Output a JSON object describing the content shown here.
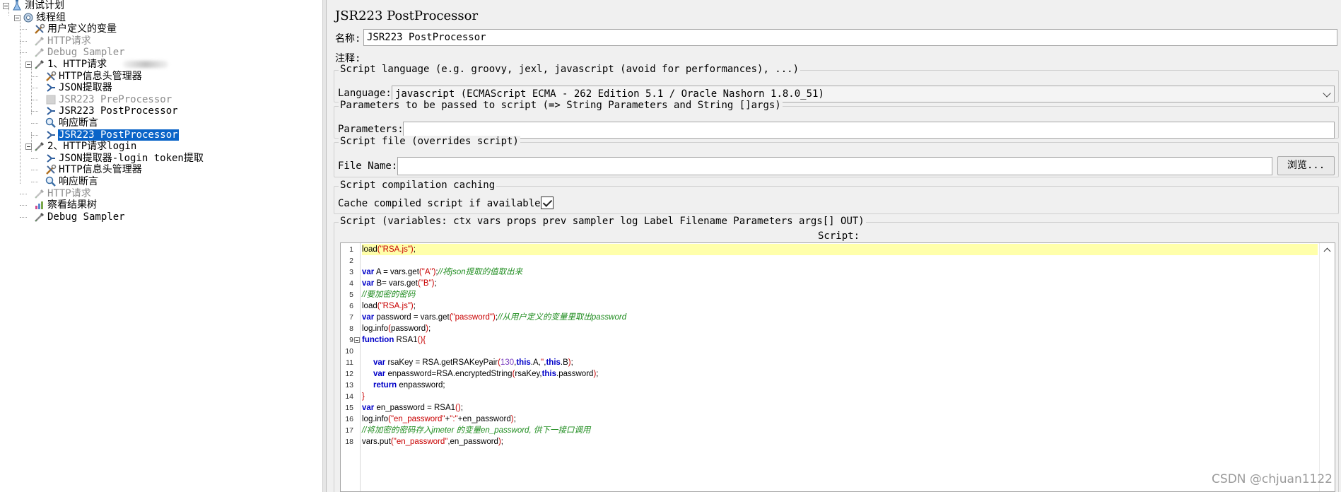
{
  "tree": {
    "items": [
      {
        "label": "测试计划",
        "icon": "test-plan-icon",
        "level": 0,
        "disabled": false,
        "selected": false,
        "expandable": true
      },
      {
        "label": "线程组",
        "icon": "thread-group-icon",
        "level": 1,
        "disabled": false,
        "selected": false,
        "expandable": true
      },
      {
        "label": "用户定义的变量",
        "icon": "config-tools-icon",
        "level": 2,
        "disabled": false,
        "selected": false,
        "expandable": false
      },
      {
        "label": "HTTP请求",
        "icon": "sampler-pipette-icon",
        "level": 2,
        "disabled": true,
        "selected": false,
        "expandable": false
      },
      {
        "label": "Debug Sampler",
        "icon": "sampler-pipette-icon",
        "level": 2,
        "disabled": true,
        "selected": false,
        "expandable": false
      },
      {
        "label": "1、HTTP请求",
        "icon": "sampler-pipette-icon",
        "level": 2,
        "disabled": false,
        "selected": false,
        "expandable": true
      },
      {
        "label": "HTTP信息头管理器",
        "icon": "config-tools-icon",
        "level": 3,
        "disabled": false,
        "selected": false,
        "expandable": false
      },
      {
        "label": "JSON提取器",
        "icon": "post-processor-icon",
        "level": 3,
        "disabled": false,
        "selected": false,
        "expandable": false
      },
      {
        "label": "JSR223 PreProcessor",
        "icon": "pre-processor-icon",
        "level": 3,
        "disabled": true,
        "selected": false,
        "expandable": false
      },
      {
        "label": "JSR223 PostProcessor",
        "icon": "post-processor-icon",
        "level": 3,
        "disabled": false,
        "selected": false,
        "expandable": false
      },
      {
        "label": "响应断言",
        "icon": "assertion-magnifier-icon",
        "level": 3,
        "disabled": false,
        "selected": false,
        "expandable": false
      },
      {
        "label": "JSR223 PostProcessor",
        "icon": "post-processor-icon",
        "level": 3,
        "disabled": false,
        "selected": true,
        "expandable": false
      },
      {
        "label": "2、HTTP请求login",
        "icon": "sampler-pipette-icon",
        "level": 2,
        "disabled": false,
        "selected": false,
        "expandable": true
      },
      {
        "label": "JSON提取器-login token提取",
        "icon": "post-processor-icon",
        "level": 3,
        "disabled": false,
        "selected": false,
        "expandable": false
      },
      {
        "label": "HTTP信息头管理器",
        "icon": "config-tools-icon",
        "level": 3,
        "disabled": false,
        "selected": false,
        "expandable": false
      },
      {
        "label": "响应断言",
        "icon": "assertion-magnifier-icon",
        "level": 3,
        "disabled": false,
        "selected": false,
        "expandable": false
      },
      {
        "label": "HTTP请求",
        "icon": "sampler-pipette-icon",
        "level": 2,
        "disabled": true,
        "selected": false,
        "expandable": false
      },
      {
        "label": "察看结果树",
        "icon": "listener-chart-icon",
        "level": 2,
        "disabled": false,
        "selected": false,
        "expandable": false
      },
      {
        "label": "Debug Sampler",
        "icon": "sampler-pipette-icon",
        "level": 2,
        "disabled": false,
        "selected": false,
        "expandable": false
      }
    ]
  },
  "panel": {
    "title": "JSR223 PostProcessor",
    "name_label": "名称:",
    "name_value": "JSR223 PostProcessor",
    "comment_label": "注释:",
    "comment_value": "",
    "language_group": "Script language (e.g. groovy, jexl, javascript (avoid for performances), ...)",
    "language_label": "Language:",
    "language_value": "javascript     (ECMAScript ECMA - 262 Edition 5.1 / Oracle Nashorn 1.8.0_51)",
    "parameters_group": "Parameters to be passed to script (=> String Parameters and String []args)",
    "parameters_label": "Parameters:",
    "parameters_value": "",
    "file_group": "Script file (overrides script)",
    "file_label": "File Name:",
    "file_value": "",
    "browse_label": "浏览...",
    "cache_group": "Script compilation caching",
    "cache_label": "Cache compiled script if available:",
    "cache_checked": true,
    "script_group": "Script (variables: ctx vars props prev sampler log Label Filename Parameters args[] OUT)",
    "script_label": "Script:"
  },
  "editor": {
    "current_line": 1,
    "fold_line": 9,
    "colors": {
      "keyword": "#0000c8",
      "string": "#c80000",
      "comment": "#1e8c1e",
      "number": "#7b3fbf",
      "highlight": "#ffffaa"
    },
    "lines": [
      "load(\"RSA.js\");",
      "",
      "var A = vars.get(\"A\");//将json提取的值取出来",
      "var B= vars.get(\"B\");",
      "//要加密的密码",
      "load(\"RSA.js\");",
      "var password = vars.get(\"password\");//从用户定义的变量里取出password",
      "log.info(password);",
      "function RSA1(){",
      "",
      "     var rsaKey = RSA.getRSAKeyPair(130,this.A,'',this.B);",
      "     var enpassword=RSA.encryptedString(rsaKey,this.password);",
      "     return enpassword;",
      "}",
      "var en_password = RSA1();",
      "log.info(\"en_password\"+\":\"+en_password);",
      "//将加密的密码存入jmeter 的变量en_password, 供下一接口调用",
      "vars.put(\"en_password\",en_password);"
    ]
  },
  "watermark": "CSDN @chjuan1122"
}
